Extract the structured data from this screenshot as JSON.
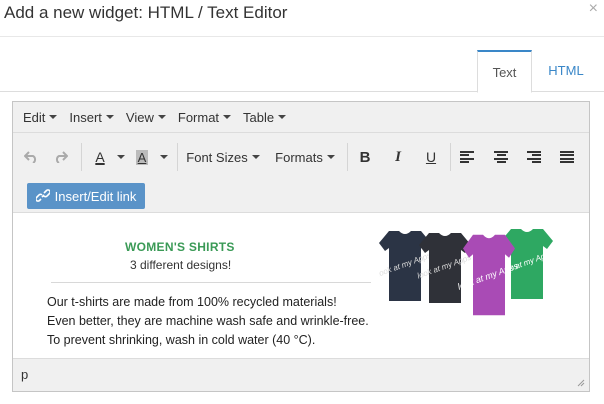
{
  "dialog": {
    "title": "Add a new widget: HTML / Text Editor"
  },
  "tabs": [
    {
      "label": "Text",
      "active": true
    },
    {
      "label": "HTML",
      "active": false
    }
  ],
  "menubar": {
    "items": [
      {
        "label": "Edit"
      },
      {
        "label": "Insert"
      },
      {
        "label": "View"
      },
      {
        "label": "Format"
      },
      {
        "label": "Table"
      }
    ]
  },
  "toolbar": {
    "font_sizes_label": "Font Sizes",
    "formats_label": "Formats",
    "text_color_glyph": "A",
    "bg_color_glyph": "A",
    "bold_glyph": "B",
    "italic_glyph": "I",
    "underline_glyph": "U",
    "insert_link_label": "Insert/Edit link",
    "text_color": "#222222",
    "bg_color": "#aaaaaa"
  },
  "content": {
    "heading": "WOMEN'S SHIRTS",
    "subheading": "3 different designs!",
    "paragraph": [
      "Our t-shirts are made from 100% recycled materials!",
      "Even better, they are machine wash safe and wrinkle-free.",
      "To prevent shrinking, wash in cold water (40 °C)."
    ],
    "shirt_print": "look at my Apps",
    "shirt_colors": [
      "#2b3445",
      "#2f3138",
      "#a94bb5",
      "#2ea862"
    ],
    "heading_color": "#3a9a56"
  },
  "statusbar": {
    "path": "p"
  },
  "colors": {
    "accent": "#3a87c8",
    "link_button": "#5a93c8"
  }
}
